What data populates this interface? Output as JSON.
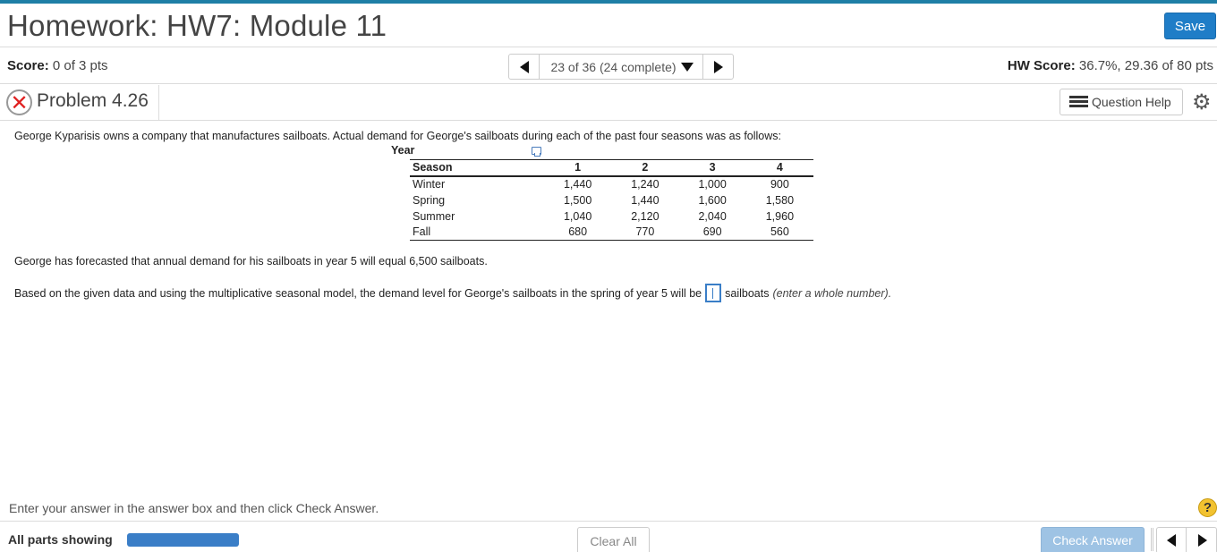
{
  "header": {
    "title": "Homework: HW7: Module 11",
    "save_label": "Save"
  },
  "score_bar": {
    "score_label": "Score:",
    "score_value": " 0 of 3 pts",
    "nav_text": "23 of 36 (24 complete)",
    "hw_score_label": "HW Score:",
    "hw_score_value": " 36.7%, 29.36 of 80 pts"
  },
  "problem": {
    "title": "Problem 4.26",
    "question_help_label": "Question Help",
    "status": "incorrect"
  },
  "content": {
    "intro": "George Kyparisis owns a company that manufactures sailboats.  Actual demand for George's sailboats during each of the past four seasons was as follows:",
    "year_label": "Year",
    "table": {
      "headers": [
        "Season",
        "1",
        "2",
        "3",
        "4"
      ],
      "rows": [
        [
          "Winter",
          "1,440",
          "1,240",
          "1,000",
          "900"
        ],
        [
          "Spring",
          "1,500",
          "1,440",
          "1,600",
          "1,580"
        ],
        [
          "Summer",
          "1,040",
          "2,120",
          "2,040",
          "1,960"
        ],
        [
          "Fall",
          "680",
          "770",
          "690",
          "560"
        ]
      ]
    },
    "forecast": "George has forecasted that annual demand for his sailboats in year 5 will equal 6,500 sailboats.",
    "question_before": "Based on the given data and using the multiplicative seasonal model, the demand level for George's sailboats in the spring of year 5 will be",
    "question_after": "sailboats",
    "question_hint": "(enter a whole number).",
    "answer_value": ""
  },
  "footer": {
    "instruction": "Enter your answer in the answer box and then click Check Answer.",
    "parts_label": "All parts showing",
    "progress": 1.0,
    "clear_label": "Clear All",
    "check_label": "Check Answer"
  },
  "colors": {
    "accent": "#1f7dc7",
    "top_border": "#1e7fa6",
    "progress": "#3a7ec7",
    "check_disabled": "#9ec3e4",
    "error": "#e02020",
    "help": "#f2c230"
  }
}
